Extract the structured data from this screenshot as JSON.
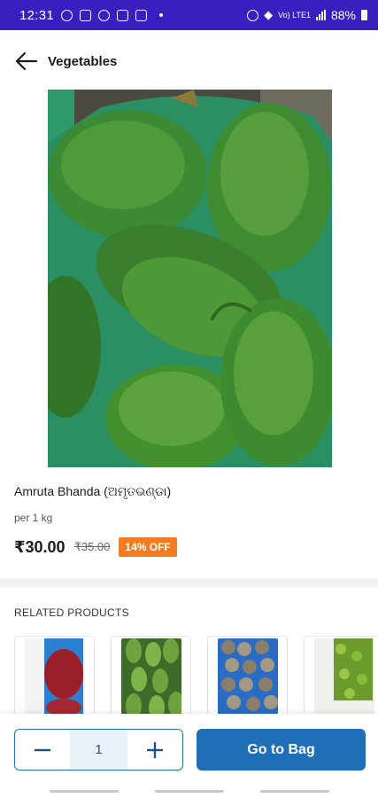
{
  "status_bar": {
    "time": "12:31",
    "battery": "88%",
    "network": "Vo) LTE1"
  },
  "header": {
    "title": "Vegetables"
  },
  "product": {
    "name": "Amruta Bhanda (ଅମୃତଭଣ୍ଡା)",
    "unit": "per 1 kg",
    "price": "₹30.00",
    "original_price": "₹35.00",
    "discount": "14% OFF"
  },
  "related": {
    "title": "RELATED PRODUCTS",
    "items": [
      {
        "icon": "red-beans-image"
      },
      {
        "icon": "green-chillies-image"
      },
      {
        "icon": "round-vegetables-image"
      },
      {
        "icon": "green-leaves-image"
      }
    ]
  },
  "bottom_bar": {
    "quantity": "1",
    "minus": "−",
    "plus": "+",
    "go_to_bag_label": "Go to Bag"
  },
  "colors": {
    "status_bar": "#3a1fc0",
    "primary": "#1f6fb8",
    "discount": "#f47b20"
  }
}
